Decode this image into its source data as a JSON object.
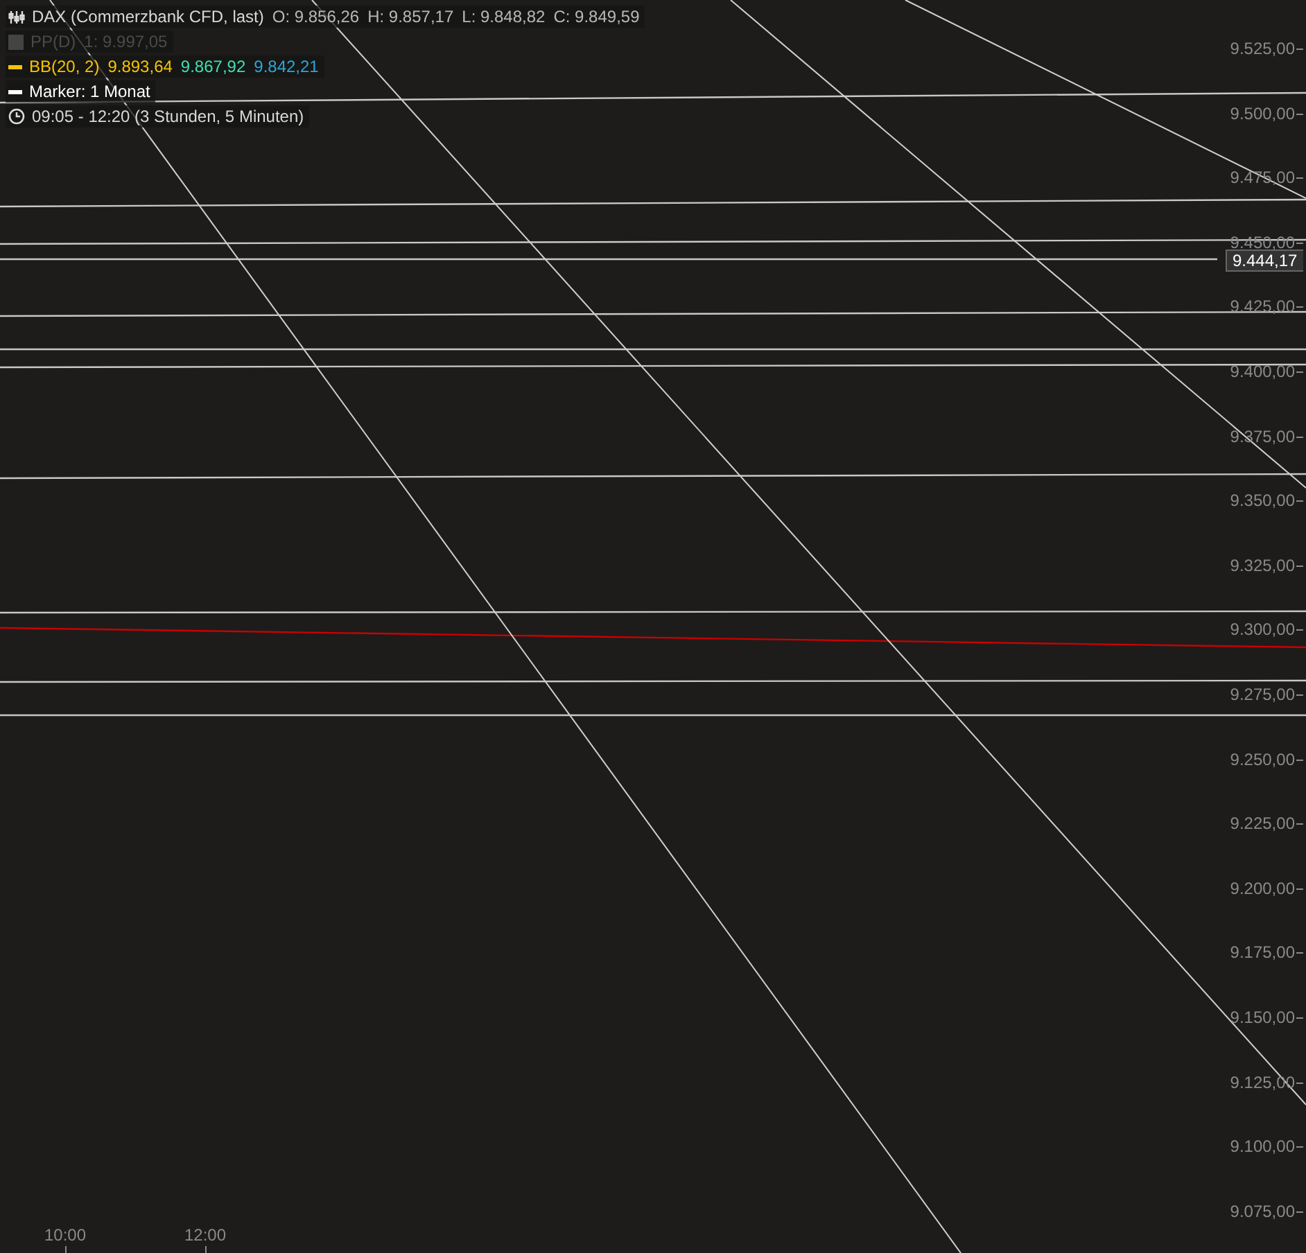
{
  "legend": [
    {
      "kind": "bars",
      "label": "DAX (Commerzbank CFD, last)",
      "disabled": false,
      "values": [
        {
          "text": "O: 9.856,26"
        },
        {
          "text": "H: 9.857,17"
        },
        {
          "text": "L: 9.848,82"
        },
        {
          "text": "C: 9.849,59"
        }
      ]
    },
    {
      "kind": "square",
      "label": "PP(D)",
      "disabled": true,
      "values": [
        {
          "text": "1: 9.997,05"
        }
      ]
    },
    {
      "kind": "dash",
      "label": "BB(20, 2)",
      "color": "#f5c400",
      "disabled": false,
      "values": [
        {
          "text": "9.893,64",
          "color": "#f5c400"
        },
        {
          "text": "9.867,92",
          "color": "#3de0b0"
        },
        {
          "text": "9.842,21",
          "color": "#2aa8d8"
        }
      ]
    },
    {
      "kind": "dash",
      "label": "Marker: 1 Monat",
      "color": "#ffffff",
      "disabled": false
    },
    {
      "kind": "clock",
      "label": "09:05 - 12:20 (3 Stunden, 5 Minuten)",
      "disabled": false
    }
  ],
  "price_tag": "9.444,17",
  "y_axis": [
    "9.525,00",
    "9.500,00",
    "9.475,00",
    "9.450,00",
    "9.425,00",
    "9.400,00",
    "9.375,00",
    "9.350,00",
    "9.325,00",
    "9.300,00",
    "9.275,00",
    "9.250,00",
    "9.225,00",
    "9.200,00",
    "9.175,00",
    "9.150,00",
    "9.125,00",
    "9.100,00",
    "9.075,00"
  ],
  "x_axis": [
    {
      "label": "10:00"
    },
    {
      "label": "12:00"
    }
  ]
}
